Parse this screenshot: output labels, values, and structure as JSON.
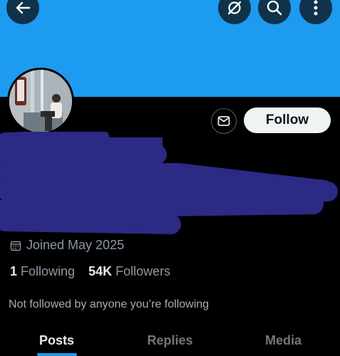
{
  "header": {
    "back_icon": "back-arrow-icon",
    "grok_icon": "grok-icon",
    "search_icon": "search-icon",
    "more_icon": "more-vertical-icon"
  },
  "colors": {
    "banner": "#1d9bf0",
    "redaction": "#2b2a84",
    "tab_indicator": "#1d9bf0"
  },
  "profile": {
    "message_icon": "mail-icon",
    "follow_label": "Follow",
    "joined": "Joined May 2025",
    "following_count": "1",
    "following_label": "Following",
    "followers_count": "54K",
    "followers_label": "Followers",
    "not_followed": "Not followed by anyone you’re following"
  },
  "tabs": [
    {
      "label": "Posts",
      "active": true
    },
    {
      "label": "Replies",
      "active": false
    },
    {
      "label": "Media",
      "active": false
    }
  ]
}
